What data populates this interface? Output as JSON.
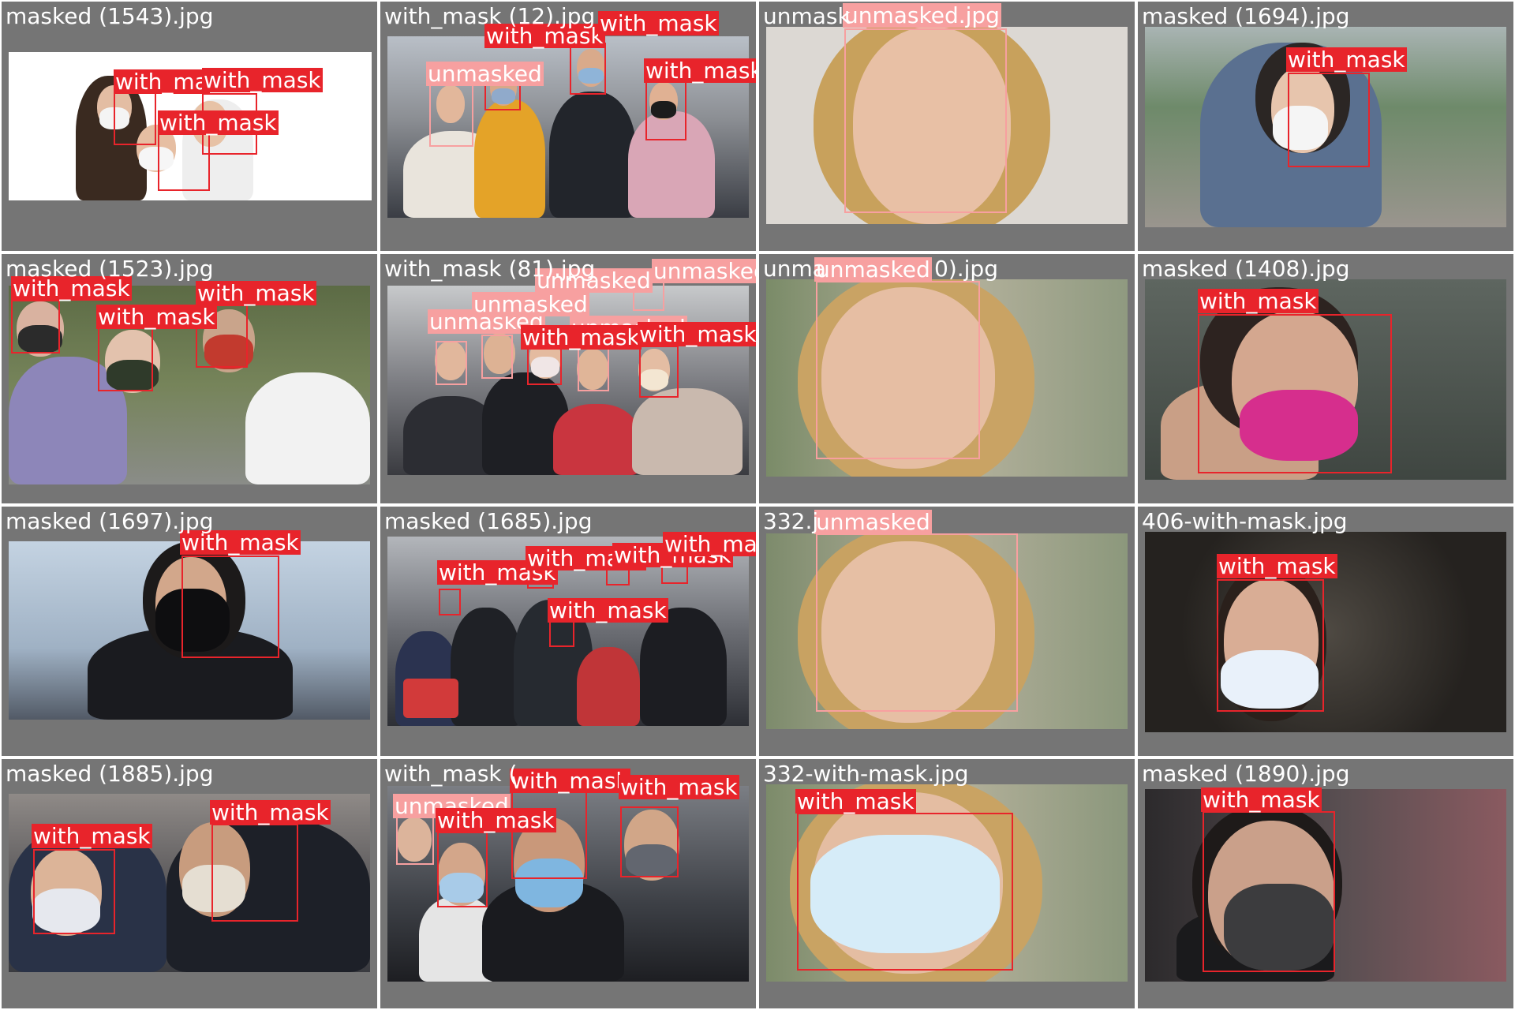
{
  "tiles": [
    {
      "filename": "masked (1543).jpg",
      "labels": [
        "with_ma",
        "with_mask",
        "with_mask"
      ]
    },
    {
      "filename": "with_mask (12).jpg",
      "labels": [
        "with_mask",
        "with_mask",
        "unmasked",
        "with_mask"
      ]
    },
    {
      "filename": "unmask",
      "labels": [
        "unmasked.jpg"
      ]
    },
    {
      "filename": "masked (1694).jpg",
      "labels": [
        "with_mask"
      ]
    },
    {
      "filename": "masked (1523).jpg",
      "labels": [
        "with_mask",
        "with_mask",
        "with_mask"
      ]
    },
    {
      "filename": "with_mask (81).jpg",
      "labels": [
        "unmasked",
        "unmasked",
        "unmasked",
        "with_mask",
        "unmasked",
        "unmasked",
        "with_mask"
      ]
    },
    {
      "filename": "unma",
      "labels": [
        "unmasked",
        "0).jpg"
      ]
    },
    {
      "filename": "masked (1408).jpg",
      "labels": [
        "with_mask"
      ]
    },
    {
      "filename": "masked (1697).jpg",
      "labels": [
        "with_mask"
      ]
    },
    {
      "filename": "masked (1685).jpg",
      "labels": [
        "with_mask",
        "with_mask",
        "with_mask",
        "with_mask",
        "with_mask"
      ]
    },
    {
      "filename": "332.j",
      "labels": [
        "unmasked"
      ]
    },
    {
      "filename": "406-with-mask.jpg",
      "labels": [
        "with_mask"
      ]
    },
    {
      "filename": "masked (1885).jpg",
      "labels": [
        "with_mask",
        "with_mask"
      ]
    },
    {
      "filename": "with_mask (",
      "labels": [
        "with_mask",
        "unmasked",
        "with_mask",
        "with_mask"
      ]
    },
    {
      "filename": "332-with-mask.jpg",
      "labels": [
        "with_mask"
      ]
    },
    {
      "filename": "masked (1890).jpg",
      "labels": [
        "with_mask"
      ]
    }
  ],
  "colors": {
    "with_mask": "#e8242b",
    "unmasked": "#f7a0a0",
    "tile_bg": "#757575"
  }
}
